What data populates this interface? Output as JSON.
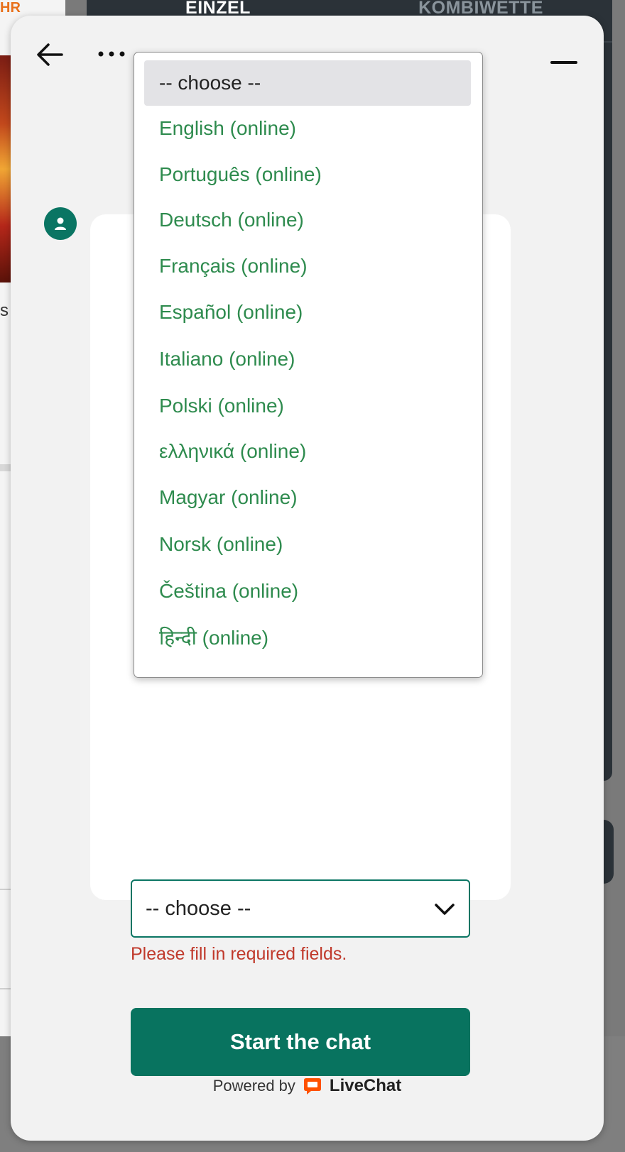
{
  "background": {
    "promo_text": "HR",
    "tabs": [
      "EINZEL",
      "KOMBIWETTE"
    ],
    "side_text": "s"
  },
  "widget": {
    "back_label": "back",
    "more_label": "more options",
    "minimize_label": "minimize"
  },
  "form": {
    "language_select": {
      "value": "-- choose --",
      "options": [
        "-- choose --",
        "English (online)",
        "Português (online)",
        "Deutsch (online)",
        "Français (online)",
        "Español (online)",
        "Italiano (online)",
        "Polski (online)",
        "ελληνικά (online)",
        "Magyar (online)",
        "Norsk (online)",
        "Čeština (online)",
        "हिन्दी (online)"
      ]
    },
    "error": "Please fill in required fields.",
    "submit_label": "Start the chat"
  },
  "footer": {
    "powered_by": "Powered by",
    "brand": "LiveChat"
  },
  "colors": {
    "accent": "#08735F",
    "option_text": "#2E8B4E",
    "error": "#C0392B"
  }
}
